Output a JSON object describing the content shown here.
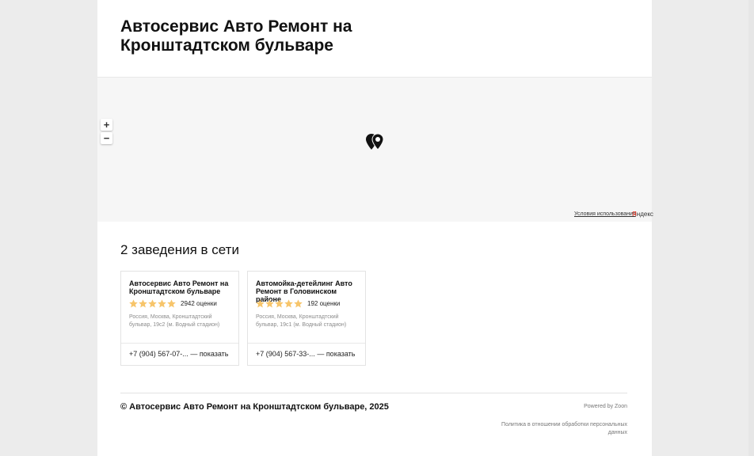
{
  "page": {
    "title": "Автосервис Авто Ремонт на Кронштадтском бульваре"
  },
  "map": {
    "zoom_in_label": "+",
    "zoom_out_label": "−",
    "terms_link": "Условия использования",
    "provider_logo_first": "Я",
    "provider_logo_rest": "ндекс"
  },
  "network": {
    "title": "2 заведения в сети",
    "cards": [
      {
        "name": "Автосервис Авто Ремонт на Кронштадтском бульваре",
        "stars": 5,
        "rating_count": "2942 оценки",
        "address": "Россия, Москва, Кронштадтский бульвар, 19с2 (м. Водный стадион)",
        "phone": "+7 (904) 567-07-...",
        "show_label": "— показать"
      },
      {
        "name": "Автомойка-детейлинг Авто Ремонт в Головинском районе",
        "stars": 5,
        "rating_count": "192 оценки",
        "address": "Россия, Москва, Кронштадтский бульвар, 19с1 (м. Водный стадион)",
        "phone": "+7 (904) 567-33-...",
        "show_label": "— показать"
      }
    ]
  },
  "footer": {
    "copyright": "© Автосервис Авто Ремонт на Кронштадтском бульваре, 2025",
    "powered_by": "Powered by Zoon",
    "privacy_link": "Политика в отношении обработки персональных данных"
  },
  "colors": {
    "star": "#f7c56b",
    "map_background": "#f6f6f6",
    "page_background": "#ececec"
  }
}
